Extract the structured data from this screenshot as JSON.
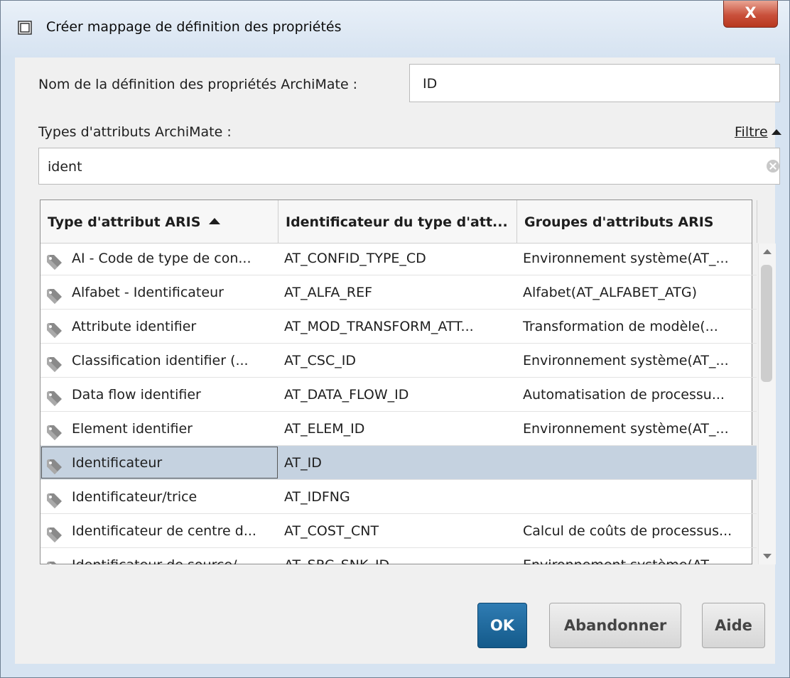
{
  "window": {
    "title": "Créer mappage de définition des propriétés",
    "close_label": "X"
  },
  "form": {
    "name_label": "Nom de la définition des propriétés ArchiMate :",
    "name_value": "ID",
    "types_label": "Types d'attributs ArchiMate :",
    "filter_link": "Filtre",
    "filter_value": "ident"
  },
  "table": {
    "columns": [
      "Type d'attribut ARIS",
      "Identificateur du type d'att...",
      "Groupes d'attributs ARIS"
    ],
    "rows": [
      {
        "name": "AI - Code de type de con...",
        "id": "AT_CONFID_TYPE_CD",
        "group": "Environnement système(AT_..."
      },
      {
        "name": "Alfabet - Identificateur",
        "id": "AT_ALFA_REF",
        "group": "Alfabet(AT_ALFABET_ATG)"
      },
      {
        "name": "Attribute identifier",
        "id": "AT_MOD_TRANSFORM_ATT...",
        "group": "Transformation de modèle(..."
      },
      {
        "name": "Classification identifier (...",
        "id": "AT_CSC_ID",
        "group": "Environnement système(AT_..."
      },
      {
        "name": "Data flow identifier",
        "id": "AT_DATA_FLOW_ID",
        "group": "Automatisation de processu..."
      },
      {
        "name": "Element identifier",
        "id": "AT_ELEM_ID",
        "group": "Environnement système(AT_..."
      },
      {
        "name": "Identificateur",
        "id": "AT_ID",
        "group": ""
      },
      {
        "name": "Identificateur/trice",
        "id": "AT_IDFNG",
        "group": ""
      },
      {
        "name": "Identificateur de centre d...",
        "id": "AT_COST_CNT",
        "group": "Calcul de coûts de processus..."
      },
      {
        "name": "Identificateur de source/...",
        "id": "AT_SRC_SNK_ID",
        "group": "Environnement système(AT_..."
      }
    ],
    "selected_row": "Identificateur"
  },
  "buttons": {
    "ok": "OK",
    "cancel": "Abandonner",
    "help": "Aide"
  },
  "colors": {
    "selected_row": "#c5d2e0",
    "ok_button": "#1f6a9e",
    "close_button": "#c9503b"
  }
}
